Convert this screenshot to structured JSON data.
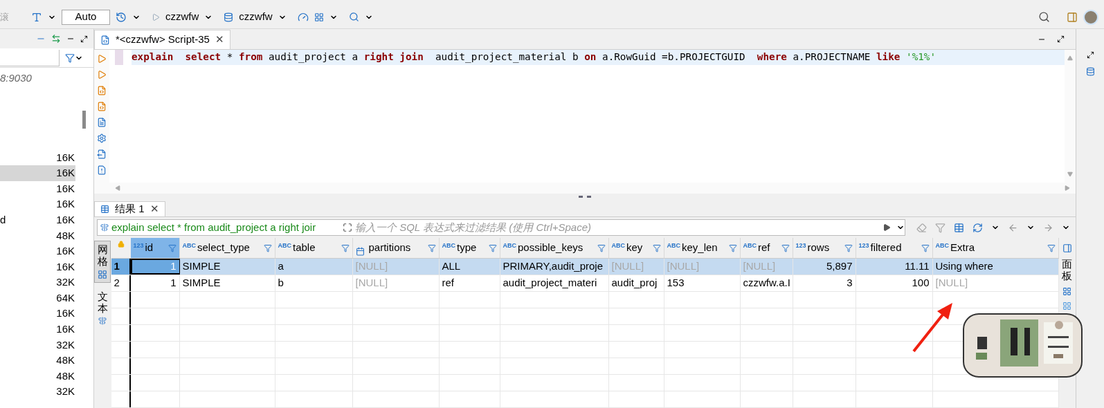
{
  "toolbar": {
    "cut_label": "滚",
    "commit_mode": "Auto",
    "connection": "czzwfw",
    "schema": "czzwfw"
  },
  "navigator": {
    "host_fragment": "8:9030",
    "items": [
      {
        "size": "16K",
        "selected": false
      },
      {
        "size": "16K",
        "selected": true
      },
      {
        "size": "16K",
        "selected": false
      },
      {
        "size": "16K",
        "selected": false
      },
      {
        "name": "d",
        "size": "16K",
        "selected": false
      },
      {
        "size": "48K",
        "selected": false
      },
      {
        "size": "16K",
        "selected": false
      },
      {
        "size": "16K",
        "selected": false
      },
      {
        "size": "32K",
        "selected": false
      },
      {
        "size": "64K",
        "selected": false
      },
      {
        "size": "16K",
        "selected": false
      },
      {
        "size": "16K",
        "selected": false
      },
      {
        "size": "32K",
        "selected": false
      },
      {
        "size": "48K",
        "selected": false
      },
      {
        "size": "48K",
        "selected": false
      },
      {
        "size": "32K",
        "selected": false
      }
    ]
  },
  "editor": {
    "tab": "*<czzwfw> Script-35",
    "tab_close": "✕",
    "sql": [
      {
        "text": "explain  ",
        "kind": "keyword"
      },
      {
        "text": "select",
        "kind": "keyword"
      },
      {
        "text": " * ",
        "kind": "plain"
      },
      {
        "text": "from",
        "kind": "keyword"
      },
      {
        "text": " audit_project a ",
        "kind": "plain"
      },
      {
        "text": "right join",
        "kind": "keyword"
      },
      {
        "text": "  audit_project_material b ",
        "kind": "plain"
      },
      {
        "text": "on",
        "kind": "keyword"
      },
      {
        "text": " a.RowGuid =b.PROJECTGUID  ",
        "kind": "plain"
      },
      {
        "text": "where",
        "kind": "keyword"
      },
      {
        "text": " a.PROJECTNAME ",
        "kind": "plain"
      },
      {
        "text": "like",
        "kind": "keyword"
      },
      {
        "text": " '%1%'",
        "kind": "string"
      }
    ]
  },
  "results": {
    "tab": "结果 1",
    "tab_close": "✕",
    "query": "explain select * from audit_project a right joir",
    "filter_placeholder": "输入一个 SQL 表达式来过滤结果 (使用 Ctrl+Space)",
    "side_tabs": [
      {
        "label": "网格",
        "selected": true
      },
      {
        "label": "文本",
        "selected": false
      }
    ],
    "panel_tab": "面板",
    "columns": [
      {
        "name": "id",
        "kind": "number",
        "type_label": "123"
      },
      {
        "name": "select_type",
        "kind": "text",
        "type_label": "ABC"
      },
      {
        "name": "table",
        "kind": "text",
        "type_label": "ABC"
      },
      {
        "name": "partitions",
        "kind": "list"
      },
      {
        "name": "type",
        "kind": "text",
        "type_label": "ABC"
      },
      {
        "name": "possible_keys",
        "kind": "text",
        "type_label": "ABC"
      },
      {
        "name": "key",
        "kind": "text",
        "type_label": "ABC"
      },
      {
        "name": "key_len",
        "kind": "text",
        "type_label": "ABC"
      },
      {
        "name": "ref",
        "kind": "text",
        "type_label": "ABC"
      },
      {
        "name": "rows",
        "kind": "number",
        "type_label": "123"
      },
      {
        "name": "filtered",
        "kind": "number",
        "type_label": "123"
      },
      {
        "name": "Extra",
        "kind": "text",
        "type_label": "ABC"
      }
    ],
    "rows": [
      {
        "number": "1",
        "selected": true,
        "cells": [
          {
            "text": "1",
            "null": false
          },
          {
            "text": "SIMPLE",
            "null": false
          },
          {
            "text": "a",
            "null": false
          },
          {
            "text": "[NULL]",
            "null": true
          },
          {
            "text": "ALL",
            "null": false
          },
          {
            "text": "PRIMARY,audit_proje",
            "null": false
          },
          {
            "text": "[NULL]",
            "null": true
          },
          {
            "text": "[NULL]",
            "null": true
          },
          {
            "text": "[NULL]",
            "null": true
          },
          {
            "text": "5,897",
            "null": false
          },
          {
            "text": "11.11",
            "null": false
          },
          {
            "text": "Using where",
            "null": false
          }
        ]
      },
      {
        "number": "2",
        "selected": false,
        "cells": [
          {
            "text": "1",
            "null": false
          },
          {
            "text": "SIMPLE",
            "null": false
          },
          {
            "text": "b",
            "null": false
          },
          {
            "text": "[NULL]",
            "null": true
          },
          {
            "text": "ref",
            "null": false
          },
          {
            "text": "audit_project_materi",
            "null": false
          },
          {
            "text": "audit_proj",
            "null": false
          },
          {
            "text": "153",
            "null": false
          },
          {
            "text": "czzwfw.a.I",
            "null": false
          },
          {
            "text": "3",
            "null": false
          },
          {
            "text": "100",
            "null": false
          },
          {
            "text": "[NULL]",
            "null": true
          }
        ]
      }
    ]
  }
}
